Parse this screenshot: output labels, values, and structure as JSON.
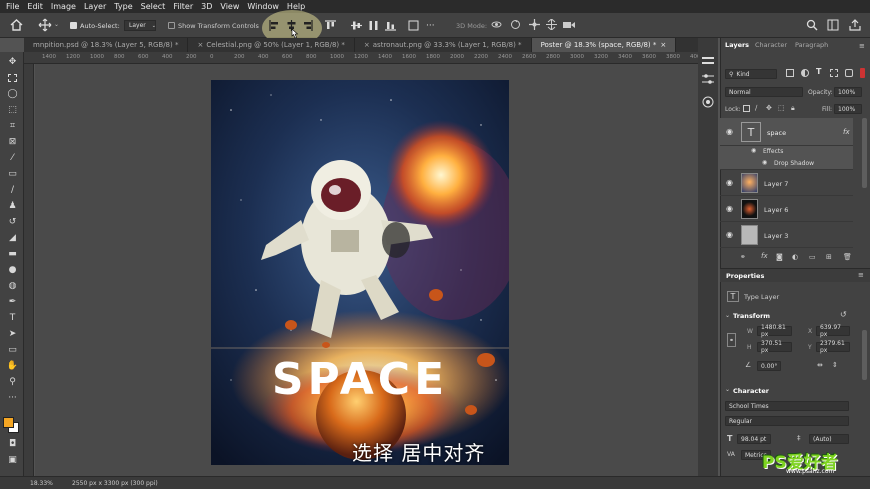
{
  "menu": [
    "File",
    "Edit",
    "Image",
    "Layer",
    "Type",
    "Select",
    "Filter",
    "3D",
    "View",
    "Window",
    "Help"
  ],
  "options_bar": {
    "auto_select_label": "Auto-Select:",
    "auto_select_value": "Layer",
    "transform_controls_label": "Show Transform Controls",
    "mode_3d_label": "3D Mode:"
  },
  "tabs": [
    {
      "label": "mnpition.psd @ 18.3% (Layer 5, RGB/8) *",
      "active": false
    },
    {
      "label": "Celestial.png @ 50% (Layer 1, RGB/8) *",
      "active": false
    },
    {
      "label": "astronaut.png @ 33.3% (Layer 1, RGB/8) *",
      "active": false
    },
    {
      "label": "Poster @ 18.3% (space, RGB/8) *",
      "active": true
    }
  ],
  "ruler": [
    "1400",
    "1200",
    "1000",
    "800",
    "600",
    "400",
    "200",
    "0",
    "200",
    "400",
    "600",
    "800",
    "1000",
    "1200",
    "1400",
    "1600",
    "1800",
    "2000",
    "2200",
    "2400",
    "2600",
    "2800",
    "3000",
    "3200",
    "3400",
    "3600",
    "3800",
    "4000"
  ],
  "artwork": {
    "title_text": "SPACE",
    "subtitle_cn": "选择 居中对齐"
  },
  "status": {
    "zoom": "18.33%",
    "doc_size": "2550 px x 3300 px (300 ppi)"
  },
  "layers_panel": {
    "tabs": [
      "Layers",
      "Character",
      "Paragraph"
    ],
    "kind_label": "Kind",
    "blend_mode": "Normal",
    "opacity_label": "Opacity:",
    "opacity_value": "100%",
    "lock_label": "Lock:",
    "fill_label": "Fill:",
    "fill_value": "100%",
    "layers": [
      {
        "name": "space",
        "type": "text",
        "fx": "fx"
      },
      {
        "name": "Effects",
        "type": "effects"
      },
      {
        "name": "Drop Shadow",
        "type": "effect"
      },
      {
        "name": "Layer 7",
        "type": "image"
      },
      {
        "name": "Layer 6",
        "type": "image"
      },
      {
        "name": "Layer 3",
        "type": "image"
      }
    ]
  },
  "properties": {
    "title": "Properties",
    "kind": "Type Layer",
    "transform_label": "Transform",
    "w_label": "W",
    "w_value": "1480.81 px",
    "x_label": "X",
    "x_value": "639.97 px",
    "h_label": "H",
    "h_value": "370.51 px",
    "y_label": "Y",
    "y_value": "2379.61 px",
    "angle_value": "0.00°",
    "character_label": "Character",
    "font_family": "School Times",
    "font_style": "Regular",
    "font_size": "98.04 pt",
    "leading": "(Auto)",
    "kerning": "Metrics"
  },
  "watermark": {
    "text": "PS爱好者",
    "url": "www.psahz.com"
  },
  "colors": {
    "menubar": "#2b2b2b",
    "panel": "#424242",
    "canvas": "#4a4a4a",
    "foreground": "#f5a623",
    "background": "#ffffff"
  }
}
